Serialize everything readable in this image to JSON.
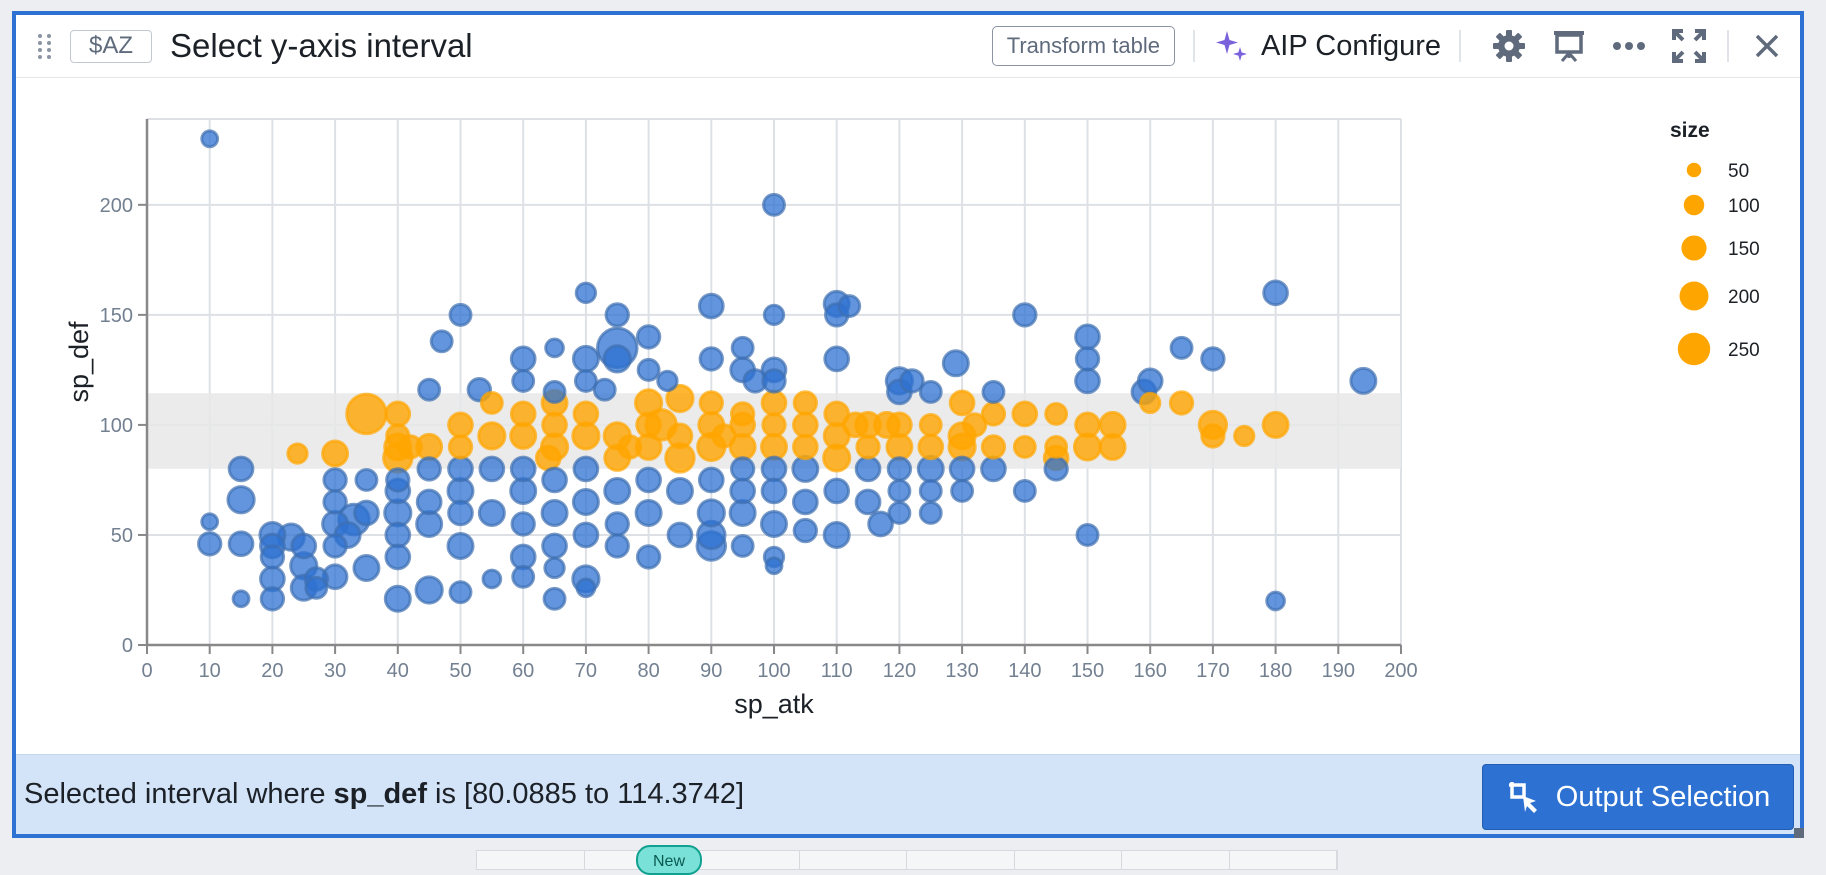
{
  "header": {
    "variable_chip": "$AZ",
    "title": "Select y-axis interval",
    "transform_table_label": "Transform table",
    "aip_configure_label": "AIP Configure",
    "icons": [
      "drag-handle-icon",
      "sparkle-icon",
      "gear-icon",
      "presentation-icon",
      "more-icon",
      "maximize-icon",
      "close-icon"
    ]
  },
  "footer": {
    "prefix": "Selected interval where ",
    "field": "sp_def",
    "suffix": " is [80.0885 to 114.3742]",
    "output_button_label": "Output Selection"
  },
  "bottom_badge": "New",
  "colors": {
    "accent": "#2d72d2",
    "selected": "#ffa500",
    "unselected": "#2d72d2",
    "brush": "#e8e8e8"
  },
  "chart_data": {
    "type": "scatter",
    "title": "",
    "xlabel": "sp_atk",
    "ylabel": "sp_def",
    "xlim": [
      0,
      200
    ],
    "ylim": [
      0,
      239
    ],
    "xticks": [
      0,
      10,
      20,
      30,
      40,
      50,
      60,
      70,
      80,
      90,
      100,
      110,
      120,
      130,
      140,
      150,
      160,
      170,
      180,
      190,
      200
    ],
    "yticks": [
      0,
      50,
      100,
      150,
      200
    ],
    "grid": true,
    "selection": {
      "field": "sp_def",
      "range": [
        80.0885,
        114.3742
      ]
    },
    "legend": {
      "title": "size",
      "placement": "right",
      "sizes": [
        50,
        100,
        150,
        200,
        250
      ]
    },
    "points": [
      [
        10,
        230,
        40
      ],
      [
        10,
        56,
        40
      ],
      [
        10,
        46,
        80
      ],
      [
        15,
        80,
        90
      ],
      [
        15,
        66,
        110
      ],
      [
        15,
        46,
        90
      ],
      [
        15,
        21,
        40
      ],
      [
        20,
        50,
        100
      ],
      [
        20,
        45,
        90
      ],
      [
        20,
        40,
        80
      ],
      [
        20,
        30,
        90
      ],
      [
        20,
        21,
        80
      ],
      [
        23,
        49,
        110
      ],
      [
        25,
        45,
        90
      ],
      [
        25,
        36,
        110
      ],
      [
        25,
        26,
        100
      ],
      [
        27,
        30,
        80
      ],
      [
        27,
        26,
        70
      ],
      [
        24,
        87,
        60
      ],
      [
        30,
        87,
        100
      ],
      [
        30,
        75,
        80
      ],
      [
        30,
        65,
        80
      ],
      [
        30,
        55,
        100
      ],
      [
        30,
        45,
        80
      ],
      [
        30,
        31,
        90
      ],
      [
        32,
        50,
        100
      ],
      [
        33,
        57,
        150
      ],
      [
        35,
        105,
        250
      ],
      [
        35,
        75,
        70
      ],
      [
        35,
        60,
        90
      ],
      [
        35,
        35,
        100
      ],
      [
        40,
        105,
        90
      ],
      [
        40,
        95,
        80
      ],
      [
        40,
        90,
        110
      ],
      [
        40,
        85,
        130
      ],
      [
        40,
        75,
        80
      ],
      [
        40,
        70,
        90
      ],
      [
        40,
        60,
        110
      ],
      [
        40,
        50,
        90
      ],
      [
        40,
        40,
        90
      ],
      [
        40,
        21,
        100
      ],
      [
        42,
        90,
        80
      ],
      [
        45,
        116,
        70
      ],
      [
        45,
        90,
        100
      ],
      [
        45,
        80,
        80
      ],
      [
        45,
        65,
        90
      ],
      [
        45,
        55,
        100
      ],
      [
        45,
        25,
        110
      ],
      [
        47,
        138,
        70
      ],
      [
        50,
        150,
        70
      ],
      [
        50,
        100,
        90
      ],
      [
        50,
        90,
        80
      ],
      [
        50,
        80,
        90
      ],
      [
        50,
        70,
        100
      ],
      [
        50,
        60,
        90
      ],
      [
        50,
        45,
        100
      ],
      [
        50,
        24,
        70
      ],
      [
        53,
        116,
        80
      ],
      [
        55,
        110,
        70
      ],
      [
        55,
        95,
        110
      ],
      [
        55,
        80,
        90
      ],
      [
        55,
        60,
        100
      ],
      [
        55,
        30,
        50
      ],
      [
        60,
        130,
        90
      ],
      [
        60,
        120,
        70
      ],
      [
        60,
        105,
        90
      ],
      [
        60,
        95,
        100
      ],
      [
        60,
        80,
        90
      ],
      [
        60,
        70,
        100
      ],
      [
        60,
        55,
        80
      ],
      [
        60,
        40,
        90
      ],
      [
        60,
        31,
        70
      ],
      [
        64,
        85,
        90
      ],
      [
        65,
        135,
        50
      ],
      [
        65,
        115,
        70
      ],
      [
        65,
        110,
        100
      ],
      [
        65,
        100,
        90
      ],
      [
        65,
        90,
        110
      ],
      [
        65,
        75,
        90
      ],
      [
        65,
        60,
        100
      ],
      [
        65,
        45,
        90
      ],
      [
        65,
        35,
        60
      ],
      [
        65,
        21,
        70
      ],
      [
        70,
        160,
        60
      ],
      [
        70,
        130,
        100
      ],
      [
        70,
        120,
        70
      ],
      [
        70,
        105,
        90
      ],
      [
        70,
        95,
        110
      ],
      [
        70,
        80,
        90
      ],
      [
        70,
        65,
        100
      ],
      [
        70,
        50,
        90
      ],
      [
        70,
        30,
        110
      ],
      [
        70,
        26,
        50
      ],
      [
        73,
        116,
        70
      ],
      [
        75,
        150,
        80
      ],
      [
        75,
        135,
        250
      ],
      [
        75,
        130,
        110
      ],
      [
        75,
        95,
        110
      ],
      [
        75,
        85,
        100
      ],
      [
        75,
        70,
        100
      ],
      [
        75,
        55,
        80
      ],
      [
        75,
        45,
        80
      ],
      [
        77,
        90,
        80
      ],
      [
        80,
        140,
        80
      ],
      [
        80,
        125,
        70
      ],
      [
        80,
        110,
        110
      ],
      [
        80,
        100,
        90
      ],
      [
        80,
        90,
        100
      ],
      [
        80,
        75,
        90
      ],
      [
        80,
        60,
        100
      ],
      [
        80,
        40,
        80
      ],
      [
        82,
        100,
        150
      ],
      [
        83,
        120,
        60
      ],
      [
        85,
        112,
        110
      ],
      [
        85,
        95,
        90
      ],
      [
        85,
        85,
        130
      ],
      [
        85,
        70,
        100
      ],
      [
        85,
        50,
        90
      ],
      [
        90,
        154,
        90
      ],
      [
        90,
        130,
        80
      ],
      [
        90,
        110,
        80
      ],
      [
        90,
        100,
        100
      ],
      [
        90,
        90,
        120
      ],
      [
        90,
        75,
        90
      ],
      [
        90,
        60,
        110
      ],
      [
        90,
        50,
        120
      ],
      [
        90,
        45,
        130
      ],
      [
        92,
        95,
        80
      ],
      [
        95,
        135,
        70
      ],
      [
        95,
        125,
        90
      ],
      [
        95,
        105,
        80
      ],
      [
        95,
        100,
        90
      ],
      [
        95,
        90,
        100
      ],
      [
        95,
        80,
        80
      ],
      [
        95,
        70,
        90
      ],
      [
        95,
        60,
        100
      ],
      [
        95,
        45,
        70
      ],
      [
        97,
        120,
        80
      ],
      [
        100,
        200,
        70
      ],
      [
        100,
        150,
        60
      ],
      [
        100,
        125,
        90
      ],
      [
        100,
        120,
        80
      ],
      [
        100,
        110,
        90
      ],
      [
        100,
        100,
        80
      ],
      [
        100,
        90,
        100
      ],
      [
        100,
        80,
        90
      ],
      [
        100,
        70,
        90
      ],
      [
        100,
        55,
        100
      ],
      [
        100,
        40,
        60
      ],
      [
        100,
        36,
        40
      ],
      [
        105,
        110,
        80
      ],
      [
        105,
        100,
        90
      ],
      [
        105,
        90,
        90
      ],
      [
        105,
        80,
        100
      ],
      [
        105,
        65,
        90
      ],
      [
        105,
        52,
        80
      ],
      [
        110,
        155,
        100
      ],
      [
        110,
        150,
        80
      ],
      [
        110,
        130,
        90
      ],
      [
        110,
        105,
        90
      ],
      [
        110,
        95,
        100
      ],
      [
        110,
        85,
        110
      ],
      [
        110,
        70,
        90
      ],
      [
        110,
        50,
        100
      ],
      [
        112,
        154,
        70
      ],
      [
        113,
        100,
        90
      ],
      [
        115,
        100,
        100
      ],
      [
        115,
        90,
        80
      ],
      [
        115,
        80,
        90
      ],
      [
        115,
        65,
        90
      ],
      [
        117,
        55,
        90
      ],
      [
        118,
        100,
        100
      ],
      [
        120,
        120,
        110
      ],
      [
        120,
        115,
        90
      ],
      [
        120,
        100,
        90
      ],
      [
        120,
        90,
        100
      ],
      [
        120,
        80,
        80
      ],
      [
        120,
        70,
        70
      ],
      [
        120,
        60,
        70
      ],
      [
        122,
        120,
        80
      ],
      [
        125,
        115,
        70
      ],
      [
        125,
        100,
        70
      ],
      [
        125,
        90,
        90
      ],
      [
        125,
        80,
        100
      ],
      [
        125,
        70,
        70
      ],
      [
        125,
        60,
        70
      ],
      [
        129,
        128,
        100
      ],
      [
        130,
        110,
        90
      ],
      [
        130,
        95,
        110
      ],
      [
        130,
        90,
        110
      ],
      [
        130,
        80,
        90
      ],
      [
        130,
        70,
        70
      ],
      [
        132,
        100,
        80
      ],
      [
        135,
        115,
        70
      ],
      [
        135,
        105,
        80
      ],
      [
        135,
        90,
        80
      ],
      [
        135,
        80,
        90
      ],
      [
        140,
        150,
        80
      ],
      [
        140,
        105,
        90
      ],
      [
        140,
        90,
        70
      ],
      [
        140,
        70,
        70
      ],
      [
        145,
        105,
        70
      ],
      [
        145,
        90,
        70
      ],
      [
        145,
        85,
        90
      ],
      [
        145,
        80,
        80
      ],
      [
        150,
        140,
        90
      ],
      [
        150,
        130,
        80
      ],
      [
        150,
        120,
        90
      ],
      [
        150,
        100,
        90
      ],
      [
        150,
        90,
        110
      ],
      [
        150,
        50,
        70
      ],
      [
        154,
        100,
        100
      ],
      [
        154,
        90,
        100
      ],
      [
        159,
        115,
        90
      ],
      [
        160,
        120,
        90
      ],
      [
        160,
        110,
        60
      ],
      [
        165,
        135,
        70
      ],
      [
        165,
        110,
        80
      ],
      [
        170,
        130,
        80
      ],
      [
        170,
        100,
        120
      ],
      [
        170,
        95,
        80
      ],
      [
        175,
        95,
        60
      ],
      [
        180,
        160,
        90
      ],
      [
        180,
        100,
        100
      ],
      [
        180,
        20,
        50
      ],
      [
        194,
        120,
        100
      ]
    ]
  }
}
